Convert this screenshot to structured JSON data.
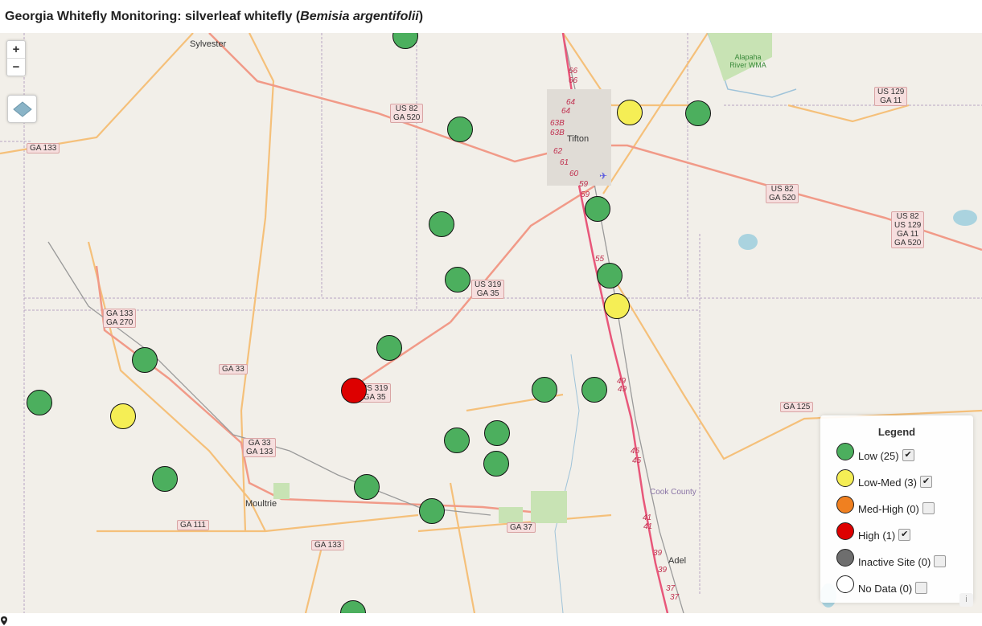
{
  "title": {
    "prefix": "Georgia Whitefly Monitoring: silverleaf whitefly (",
    "species": "Bemisia argentifolii",
    "suffix": ")"
  },
  "zoom": {
    "in": "+",
    "out": "−"
  },
  "legend": {
    "title": "Legend",
    "items": [
      {
        "label": "Low (25)",
        "color": "#4caf5e",
        "checked": true
      },
      {
        "label": "Low-Med (3)",
        "color": "#f5ee55",
        "checked": true
      },
      {
        "label": "Med-High (0)",
        "color": "#f08020",
        "checked": false
      },
      {
        "label": "High (1)",
        "color": "#dd0000",
        "checked": true
      },
      {
        "label": "Inactive Site (0)",
        "color": "#6e6e6e",
        "checked": false
      },
      {
        "label": "No Data (0)",
        "color": "#ffffff",
        "checked": false
      }
    ]
  },
  "places": [
    "Sylvester",
    "Tifton",
    "Moultrie",
    "Adel",
    "Cook County",
    "Alapaha River WMA"
  ],
  "roads": [
    "US 82 GA 520",
    "GA 133",
    "US 129 GA 11",
    "US 82 GA 520",
    "US 82 US 129 GA 11 GA 520",
    "US 319 GA 35",
    "GA 133 GA 270",
    "GA 33",
    "US 319 GA 35",
    "GA 125",
    "GA 33 GA 133",
    "GA 111",
    "GA 133",
    "GA 37"
  ],
  "interstate_labels": [
    "66",
    "66",
    "64",
    "63B",
    "64",
    "63B",
    "62",
    "61",
    "60",
    "59",
    "59",
    "55",
    "49",
    "49",
    "45",
    "45",
    "41",
    "41",
    "39",
    "39",
    "37",
    "37"
  ],
  "info": "i",
  "sites": [
    {
      "level": "Low"
    },
    {
      "level": "Low-Med"
    },
    {
      "level": "Low"
    },
    {
      "level": "Low"
    },
    {
      "level": "Low"
    },
    {
      "level": "Low"
    },
    {
      "level": "Low"
    },
    {
      "level": "Low"
    },
    {
      "level": "Low-Med"
    },
    {
      "level": "Low"
    },
    {
      "level": "Low"
    },
    {
      "level": "Low"
    },
    {
      "level": "Low-Med"
    },
    {
      "level": "High"
    },
    {
      "level": "Low"
    },
    {
      "level": "Low"
    },
    {
      "level": "Low"
    },
    {
      "level": "Low"
    },
    {
      "level": "Low"
    },
    {
      "level": "Low"
    },
    {
      "level": "Low"
    },
    {
      "level": "Low"
    },
    {
      "level": "Low"
    },
    {
      "level": "Low"
    },
    {
      "level": "Low"
    },
    {
      "level": "Low"
    },
    {
      "level": "Low"
    },
    {
      "level": "Low"
    },
    {
      "level": "Low"
    }
  ]
}
